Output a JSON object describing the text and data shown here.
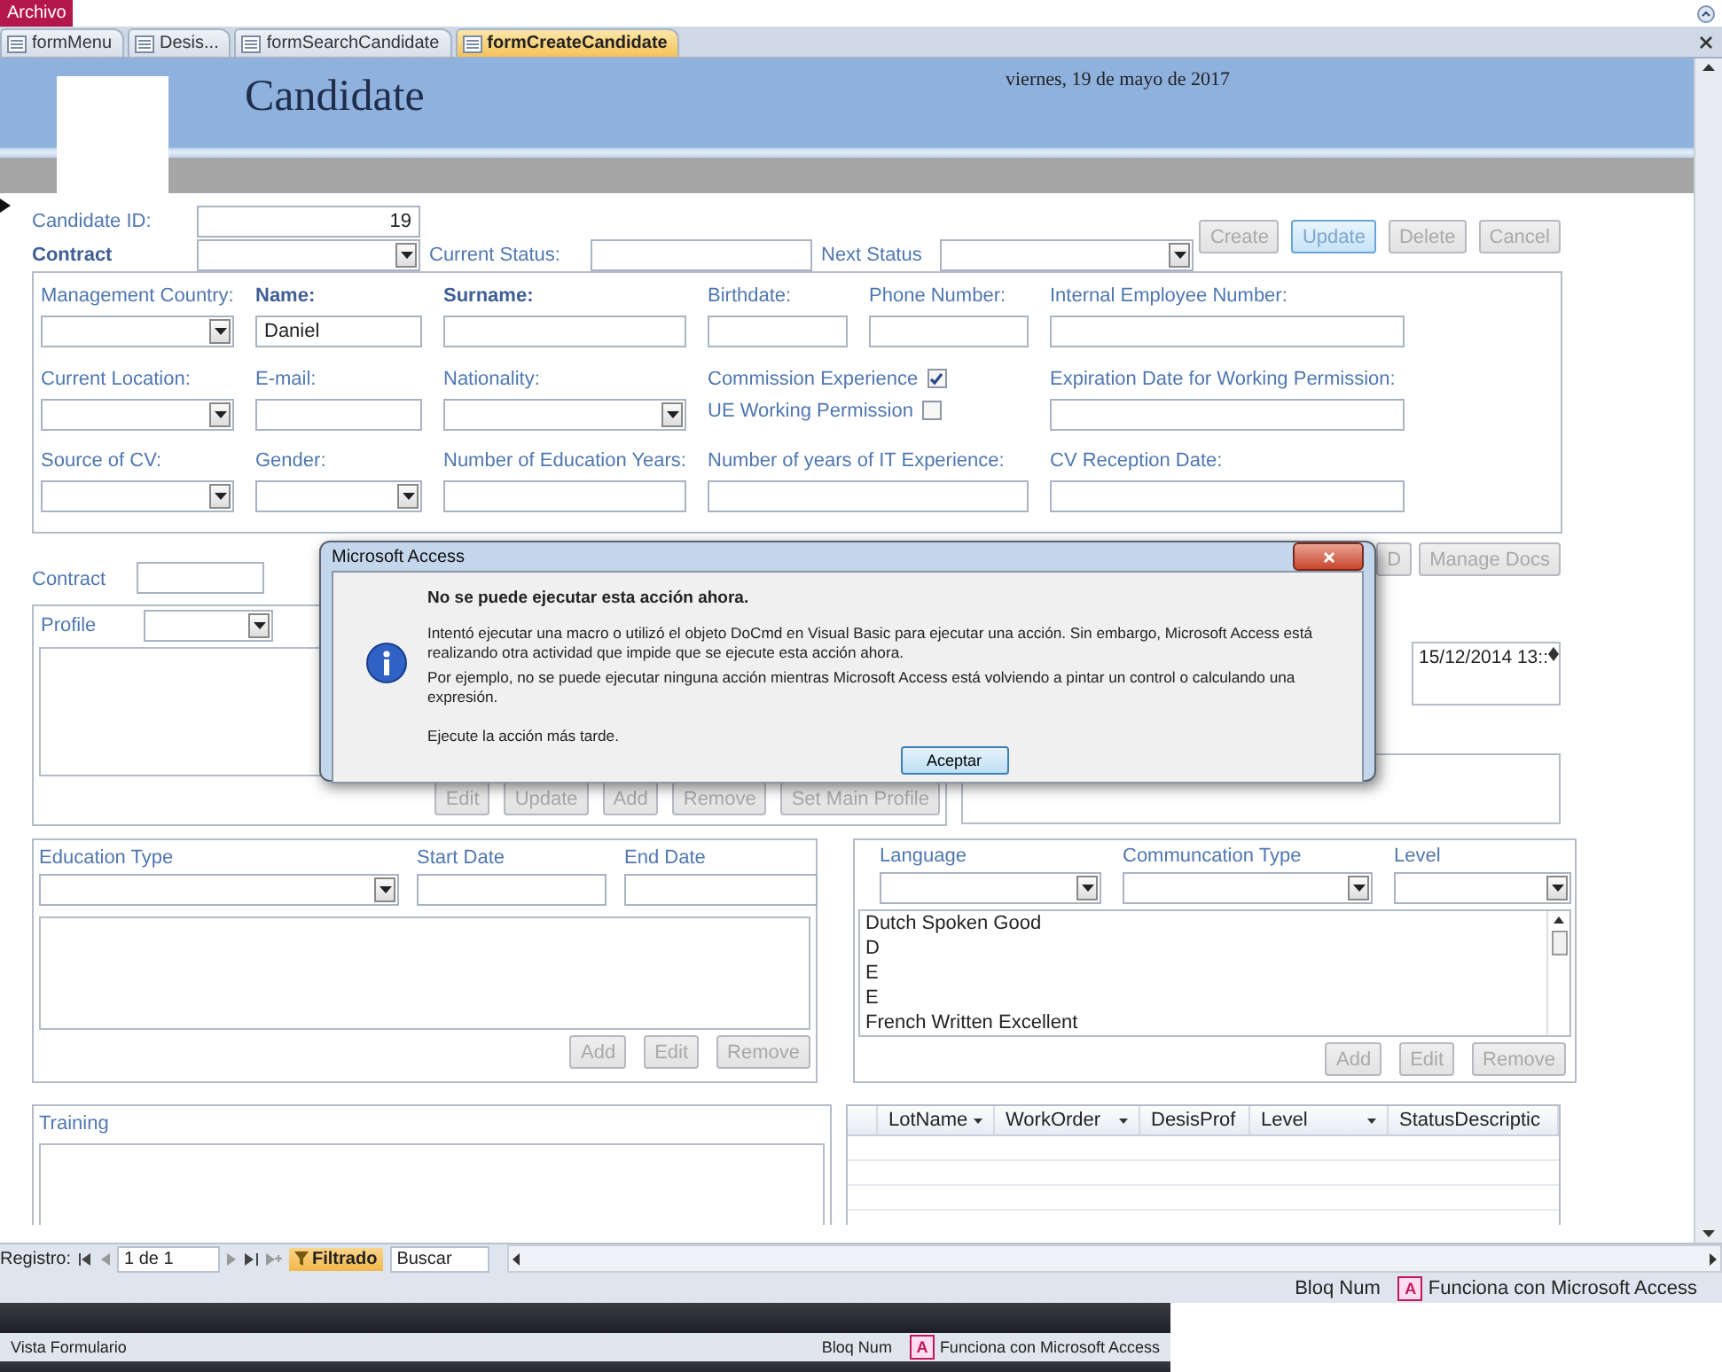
{
  "menu": {
    "file_tab": "Archivo"
  },
  "doc_tabs": [
    {
      "label": "formMenu",
      "selected": false
    },
    {
      "label": "Desis...",
      "selected": false
    },
    {
      "label": "formSearchCandidate",
      "selected": false
    },
    {
      "label": "formCreateCandidate",
      "selected": true
    }
  ],
  "header": {
    "title": "Candidate",
    "date": "viernes, 19 de mayo de 2017"
  },
  "top": {
    "candidate_id_label": "Candidate ID:",
    "candidate_id": "19",
    "contract_label": "Contract",
    "current_status_label": "Current Status:",
    "next_status_label": "Next Status"
  },
  "actions": [
    {
      "label": "Create",
      "disabled": true,
      "focused": false
    },
    {
      "label": "Update",
      "disabled": false,
      "focused": true
    },
    {
      "label": "Delete",
      "disabled": true,
      "focused": false
    },
    {
      "label": "Cancel",
      "disabled": true,
      "focused": false
    }
  ],
  "details": [
    [
      {
        "kind": "combo",
        "label": "Management Country:",
        "bold": false
      },
      {
        "kind": "text",
        "label": "Name:",
        "bold": true,
        "value": "Daniel"
      },
      {
        "kind": "text",
        "label": "Surname:",
        "bold": true
      },
      {
        "kind": "text",
        "label": "Birthdate:",
        "bold": false
      },
      {
        "kind": "text",
        "label": "Phone Number:",
        "bold": false
      },
      {
        "kind": "text",
        "label": "Internal Employee Number:",
        "bold": false
      }
    ],
    [
      {
        "kind": "combo",
        "label": "Current Location:",
        "bold": false
      },
      {
        "kind": "text",
        "label": "E-mail:",
        "bold": false
      },
      {
        "kind": "combo",
        "label": "Nationality:",
        "bold": false
      },
      {
        "kind": "checks",
        "items": [
          {
            "label": "Commission Experience",
            "checked": true
          },
          {
            "label": "UE Working Permission",
            "checked": false
          }
        ]
      },
      {
        "kind": "text",
        "label": "Expiration Date for Working Permission:",
        "bold": false
      }
    ],
    [
      {
        "kind": "combo",
        "label": "Source of CV:",
        "bold": false
      },
      {
        "kind": "combo",
        "label": "Gender:",
        "bold": false
      },
      {
        "kind": "text",
        "label": "Number of Education Years:",
        "bold": false
      },
      {
        "kind": "text",
        "label": "Number of years of IT Experience:",
        "bold": false
      },
      {
        "kind": "text",
        "label": "CV Reception Date:",
        "bold": false
      }
    ]
  ],
  "contract_row": {
    "label": "Contract",
    "buttons": [
      {
        "label": "D",
        "disabled": true
      },
      {
        "label": "Manage Docs",
        "disabled": true
      }
    ]
  },
  "profile": {
    "label": "Profile",
    "buttons": [
      {
        "label": "Edit",
        "disabled": true
      },
      {
        "label": "Update",
        "disabled": true
      },
      {
        "label": "Add",
        "disabled": true
      },
      {
        "label": "Remove",
        "disabled": true
      },
      {
        "label": "Set Main Profile",
        "disabled": true
      }
    ]
  },
  "history": {
    "entries": [
      "15/12/2014 13::"
    ]
  },
  "education": {
    "columns": [
      "Education Type",
      "Start Date",
      "End Date"
    ],
    "buttons": [
      {
        "label": "Add",
        "disabled": true
      },
      {
        "label": "Edit",
        "disabled": true
      },
      {
        "label": "Remove",
        "disabled": true
      }
    ]
  },
  "languages": {
    "columns": [
      "Language",
      "Communcation Type",
      "Level"
    ],
    "items": [
      "Dutch Spoken Good",
      "D",
      "E",
      "E",
      "French Written Excellent"
    ],
    "buttons": [
      {
        "label": "Add",
        "disabled": true
      },
      {
        "label": "Edit",
        "disabled": true
      },
      {
        "label": "Remove",
        "disabled": true
      }
    ]
  },
  "training": {
    "label": "Training"
  },
  "assignments": {
    "columns": [
      "LotName",
      "WorkOrder",
      "DesisProf",
      "Level",
      "StatusDescriptic"
    ]
  },
  "navigation": {
    "label": "Registro:",
    "position": "1 de 1",
    "filter": "Filtrado",
    "search": "Buscar"
  },
  "status_bar": {
    "num_lock": "Bloq Num",
    "app_icon": "A",
    "app_status": "Funciona con Microsoft Access"
  },
  "second_status_bar": {
    "view": "Vista Formulario",
    "num_lock": "Bloq Num",
    "app_icon": "A",
    "app_status": "Funciona con Microsoft Access"
  },
  "dialog": {
    "title": "Microsoft Access",
    "heading": "No se puede ejecutar esta acción ahora.",
    "paragraphs": [
      "Intentó ejecutar una macro o utilizó el objeto DoCmd en Visual Basic para ejecutar una acción. Sin embargo, Microsoft Access está realizando otra actividad que impide que se ejecute esta acción ahora.",
      "Por ejemplo, no se puede ejecutar ninguna acción mientras Microsoft Access está volviendo a pintar un control o calculando una expresión.",
      "Ejecute la acción más tarde."
    ],
    "button": "Aceptar"
  }
}
